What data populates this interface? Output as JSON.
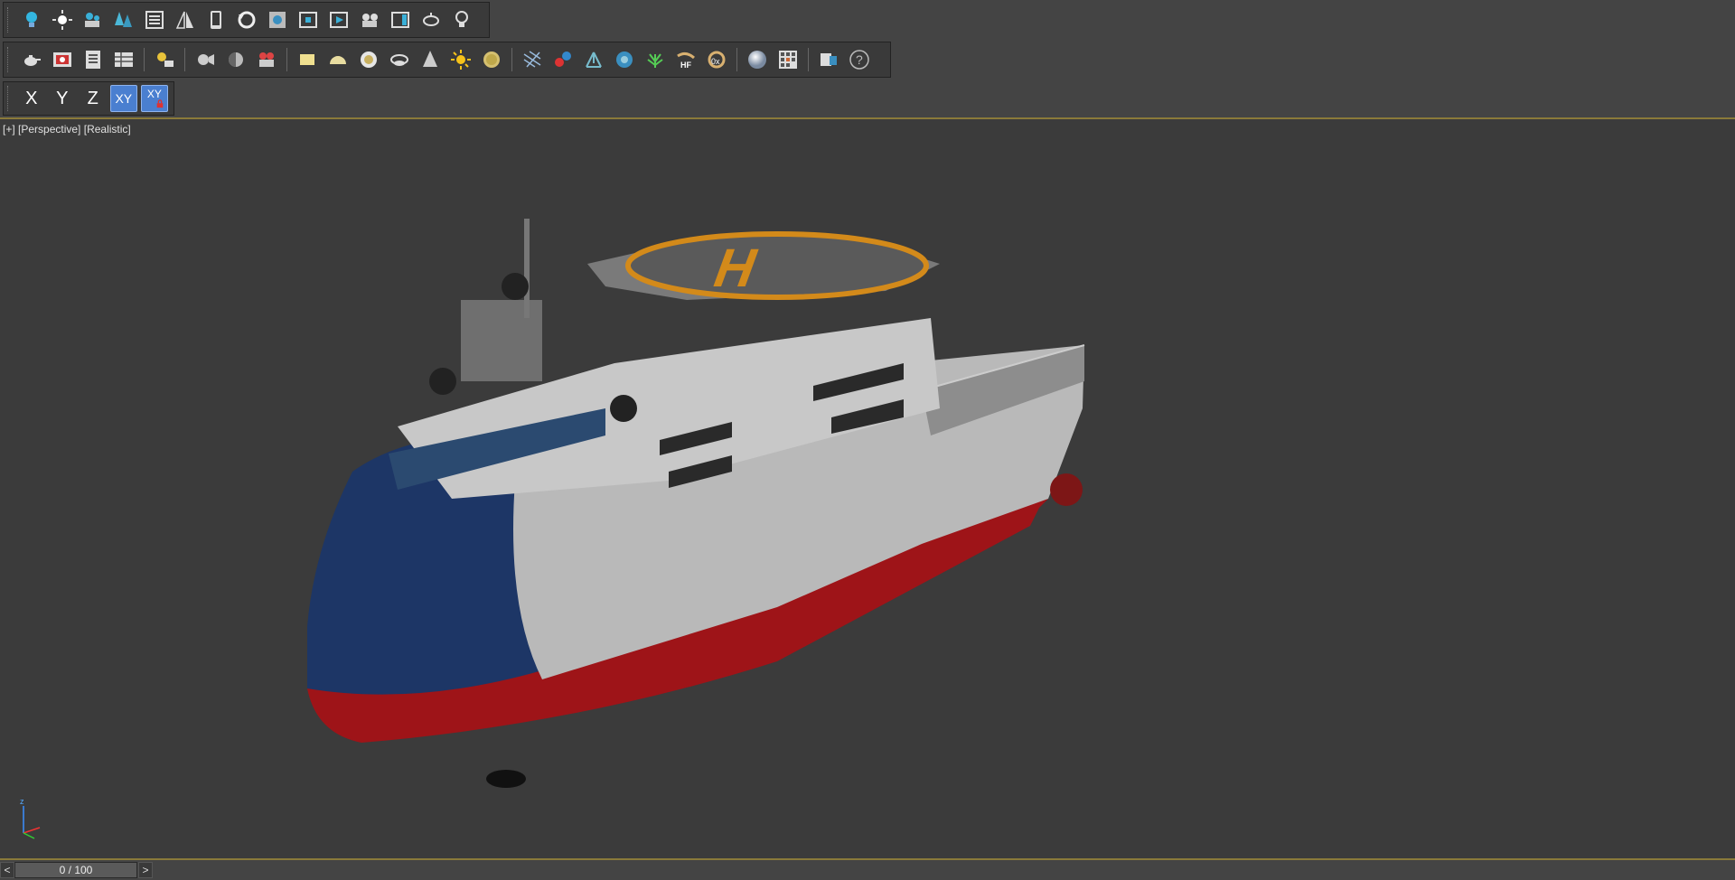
{
  "toolbar_row1": {
    "icons": [
      "light-bulb-icon",
      "sun-light-icon",
      "camera-group-icon",
      "trees-icon",
      "list-icon",
      "mirror-icon",
      "mobile-icon",
      "rotate-icon",
      "render-frame-icon",
      "align-icon",
      "render-icon",
      "camera-multi-icon",
      "viewport-icon",
      "teapot-lamp-icon",
      "bulb-outline-icon"
    ]
  },
  "toolbar_row2": {
    "icons": [
      "teapot-icon",
      "rendered-frame-icon",
      "render-setup-icon",
      "render-table-icon",
      "light-lister-icon",
      "camera-icon",
      "sphere-camera-icon",
      "film-camera-icon",
      "plane-icon",
      "dome-icon",
      "disc-icon",
      "crown-icon",
      "cone-icon",
      "sunlight-icon",
      "sphere-gold-icon",
      "grid-icon",
      "molecule-icon",
      "tripod-icon",
      "gear-sphere-icon",
      "plant-icon",
      "hf-icon",
      "ox-icon",
      "gray-sphere-icon",
      "map-browser-icon",
      "layer-icon",
      "help-icon"
    ],
    "hf_text": "HF",
    "ox_text": "0x"
  },
  "axis_toolbar": {
    "x": "X",
    "y": "Y",
    "z": "Z",
    "xy": "XY",
    "xy_lock": "XY"
  },
  "viewport": {
    "label_plus": "[+]",
    "label_view": "[Perspective]",
    "label_shading": "[Realistic]",
    "gizmo_axis": "z"
  },
  "timeline": {
    "prev": "<",
    "frame": "0 / 100",
    "next": ">"
  },
  "colors": {
    "background": "#444444",
    "viewport": "#3b3b3b",
    "accent_line": "#8a7a3a",
    "active_button": "#4a7fd0",
    "hull_blue": "#1d3666",
    "hull_red": "#a01418",
    "superstructure": "#bdbdbd",
    "helipad_orange": "#d38a1a"
  }
}
